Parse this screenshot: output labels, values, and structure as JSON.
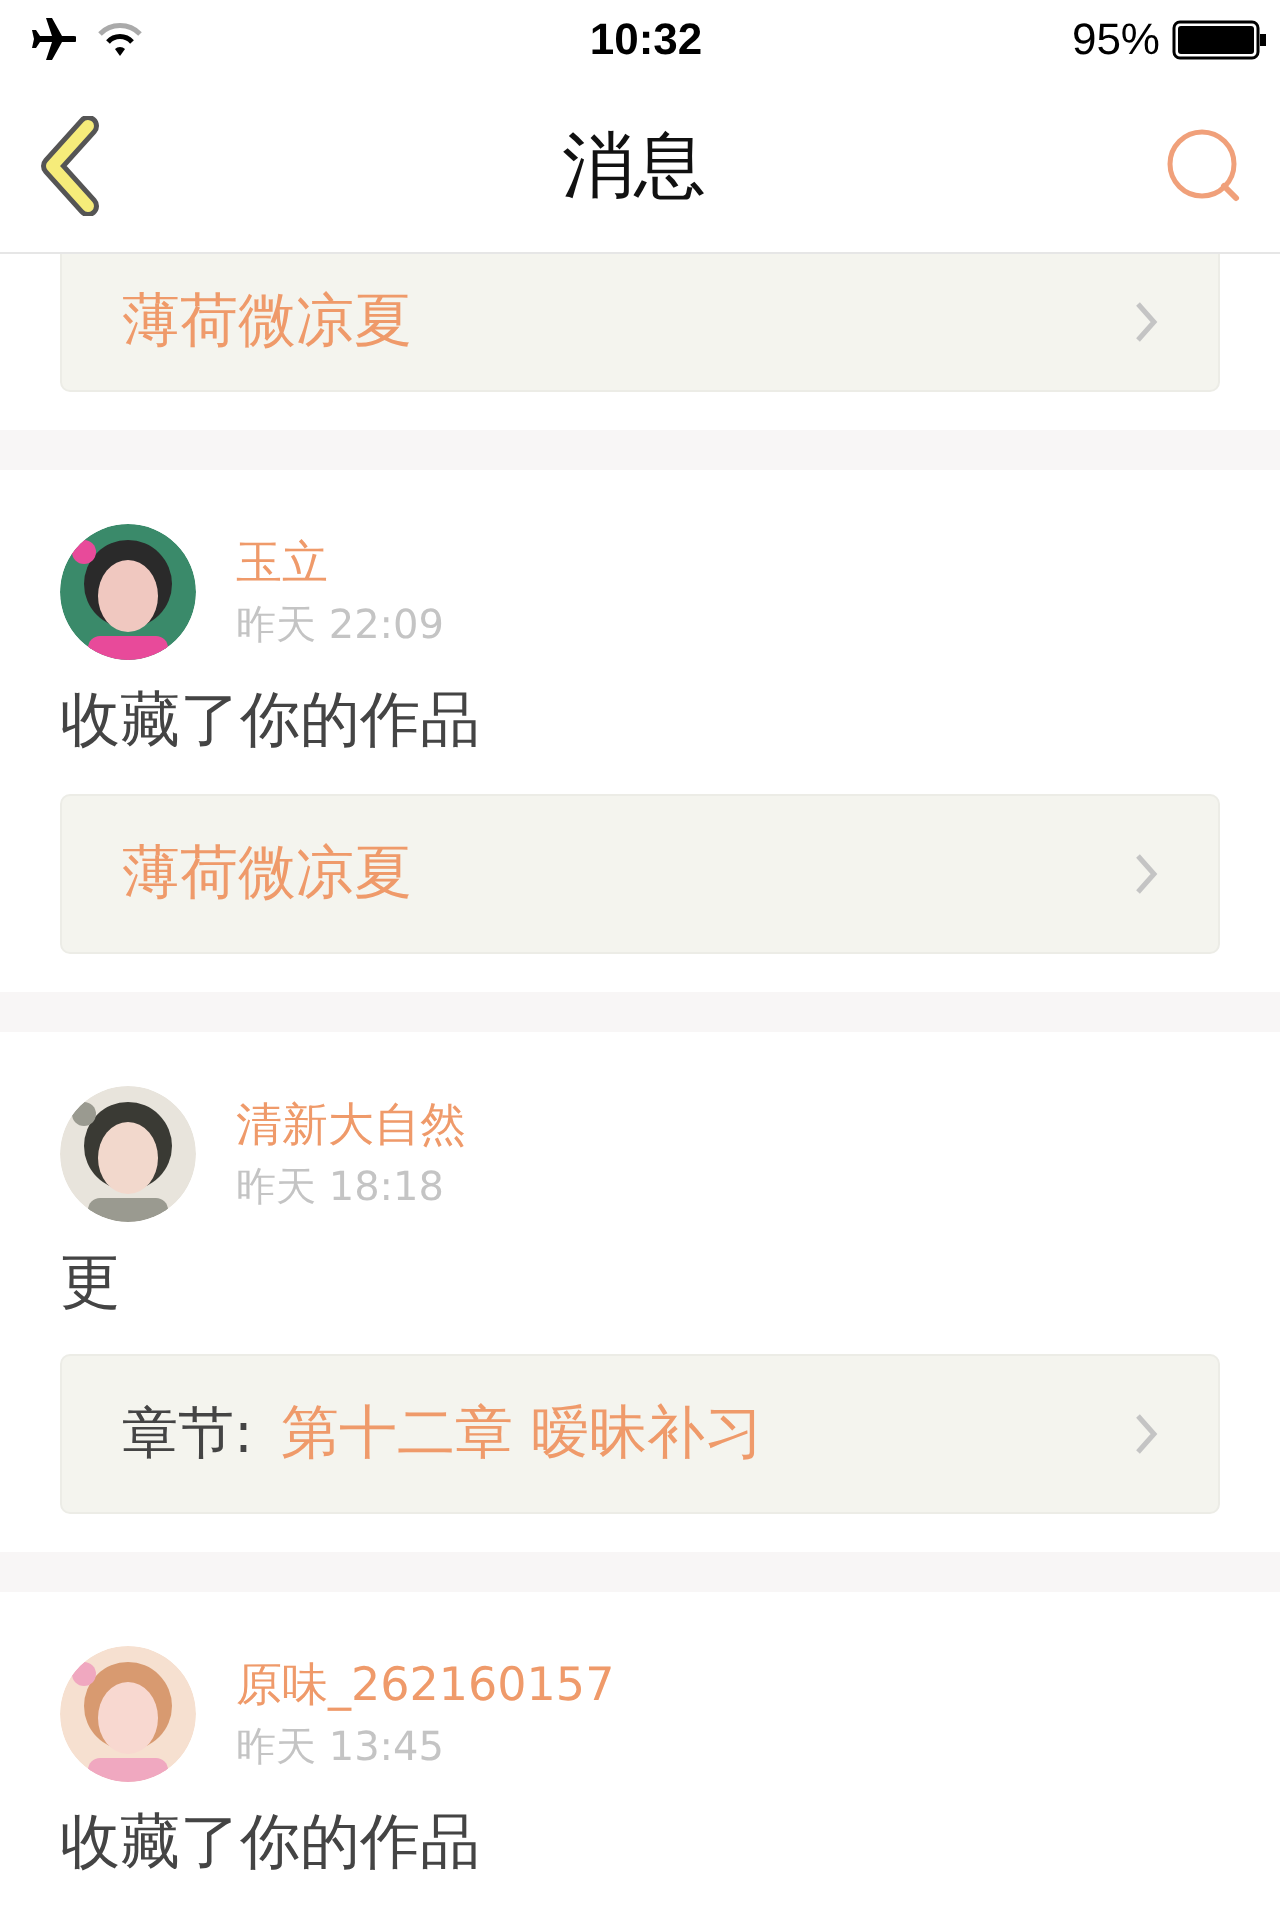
{
  "status_bar": {
    "time": "10:32",
    "battery": "95%"
  },
  "nav": {
    "title": "消息"
  },
  "messages": [
    {
      "partial": true,
      "link": {
        "title": "薄荷微凉夏"
      }
    },
    {
      "user": "玉立",
      "time": "昨天 22:09",
      "text": "收藏了你的作品",
      "link": {
        "title": "薄荷微凉夏"
      }
    },
    {
      "user": "清新大自然",
      "time": "昨天 18:18",
      "text": "更",
      "link": {
        "label": "章节:",
        "title": "第十二章 暧昧补习"
      }
    },
    {
      "user": "原味_262160157",
      "time": "昨天 13:45",
      "text": "收藏了你的作品"
    }
  ]
}
